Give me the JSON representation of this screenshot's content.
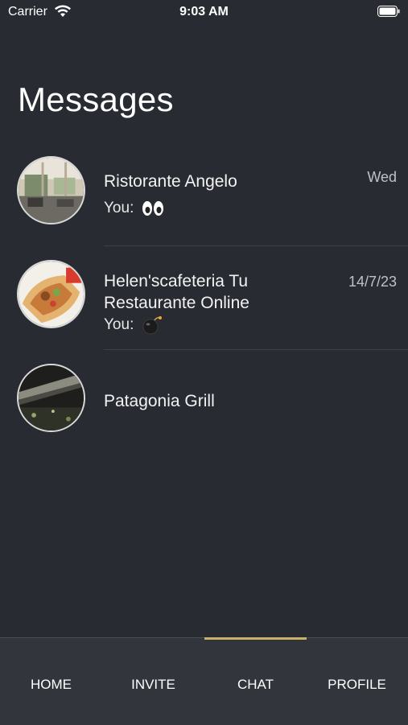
{
  "status_bar": {
    "carrier": "Carrier",
    "time": "9:03 AM"
  },
  "page_title": "Messages",
  "chats": [
    {
      "name": "Ristorante Angelo",
      "preview": "You:",
      "preview_emoji": "eyes",
      "date": "Wed"
    },
    {
      "name": "Helen'scafeteria Tu Restaurante Online",
      "preview": "You:",
      "preview_emoji": "bomb",
      "date": "14/7/23"
    },
    {
      "name": "Patagonia Grill",
      "preview": "",
      "date": ""
    }
  ],
  "tabs": [
    {
      "label": "HOME",
      "active": false
    },
    {
      "label": "INVITE",
      "active": false
    },
    {
      "label": "CHAT",
      "active": true
    },
    {
      "label": "PROFILE",
      "active": false
    }
  ],
  "colors": {
    "background": "#282b31",
    "tab_bar": "#32353c",
    "accent": "#c9b36b"
  }
}
